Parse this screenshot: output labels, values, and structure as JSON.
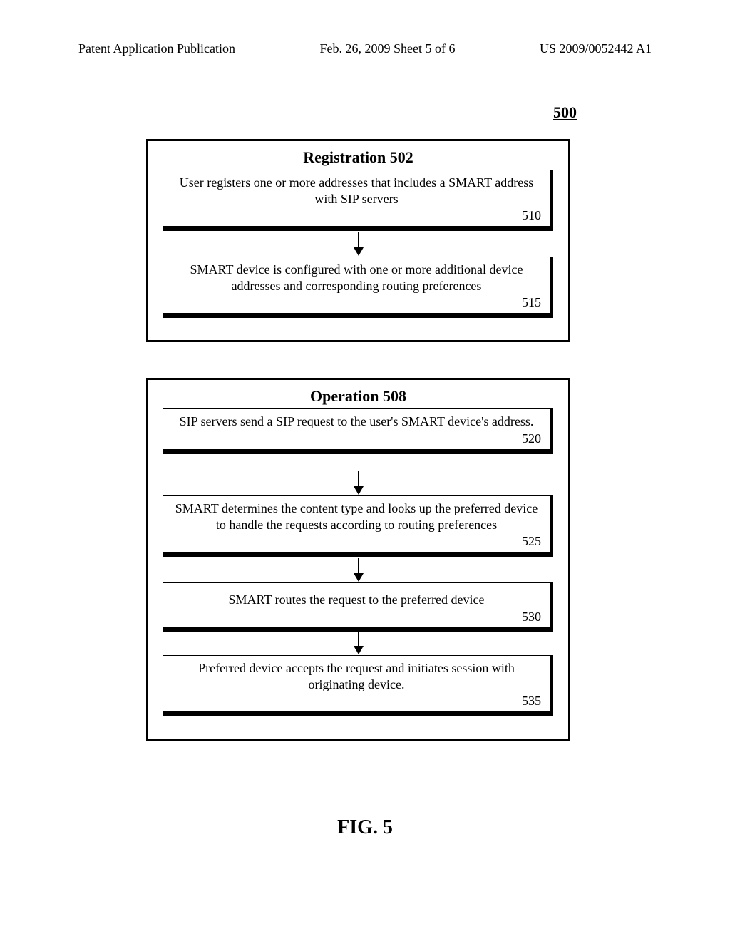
{
  "header": {
    "left": "Patent Application Publication",
    "center": "Feb. 26, 2009  Sheet 5 of 6",
    "right": "US 2009/0052442 A1"
  },
  "figure_number": "500",
  "figure_label": "FIG. 5",
  "registration": {
    "title": "Registration 502",
    "step1": {
      "text": "User registers one or more addresses that includes a SMART address with SIP servers",
      "number": "510"
    },
    "step2": {
      "text": "SMART device is configured with one or more additional device addresses and corresponding routing preferences",
      "number": "515"
    }
  },
  "operation": {
    "title": "Operation 508",
    "step1": {
      "text": "SIP servers send a SIP request to the user's SMART device's address.",
      "number": "520"
    },
    "step2": {
      "text": "SMART determines the content type and looks up the preferred device to handle the requests according to routing preferences",
      "number": "525"
    },
    "step3": {
      "text": "SMART routes the request to the preferred device",
      "number": "530"
    },
    "step4": {
      "text": "Preferred device accepts the request and initiates session with originating device.",
      "number": "535"
    }
  }
}
